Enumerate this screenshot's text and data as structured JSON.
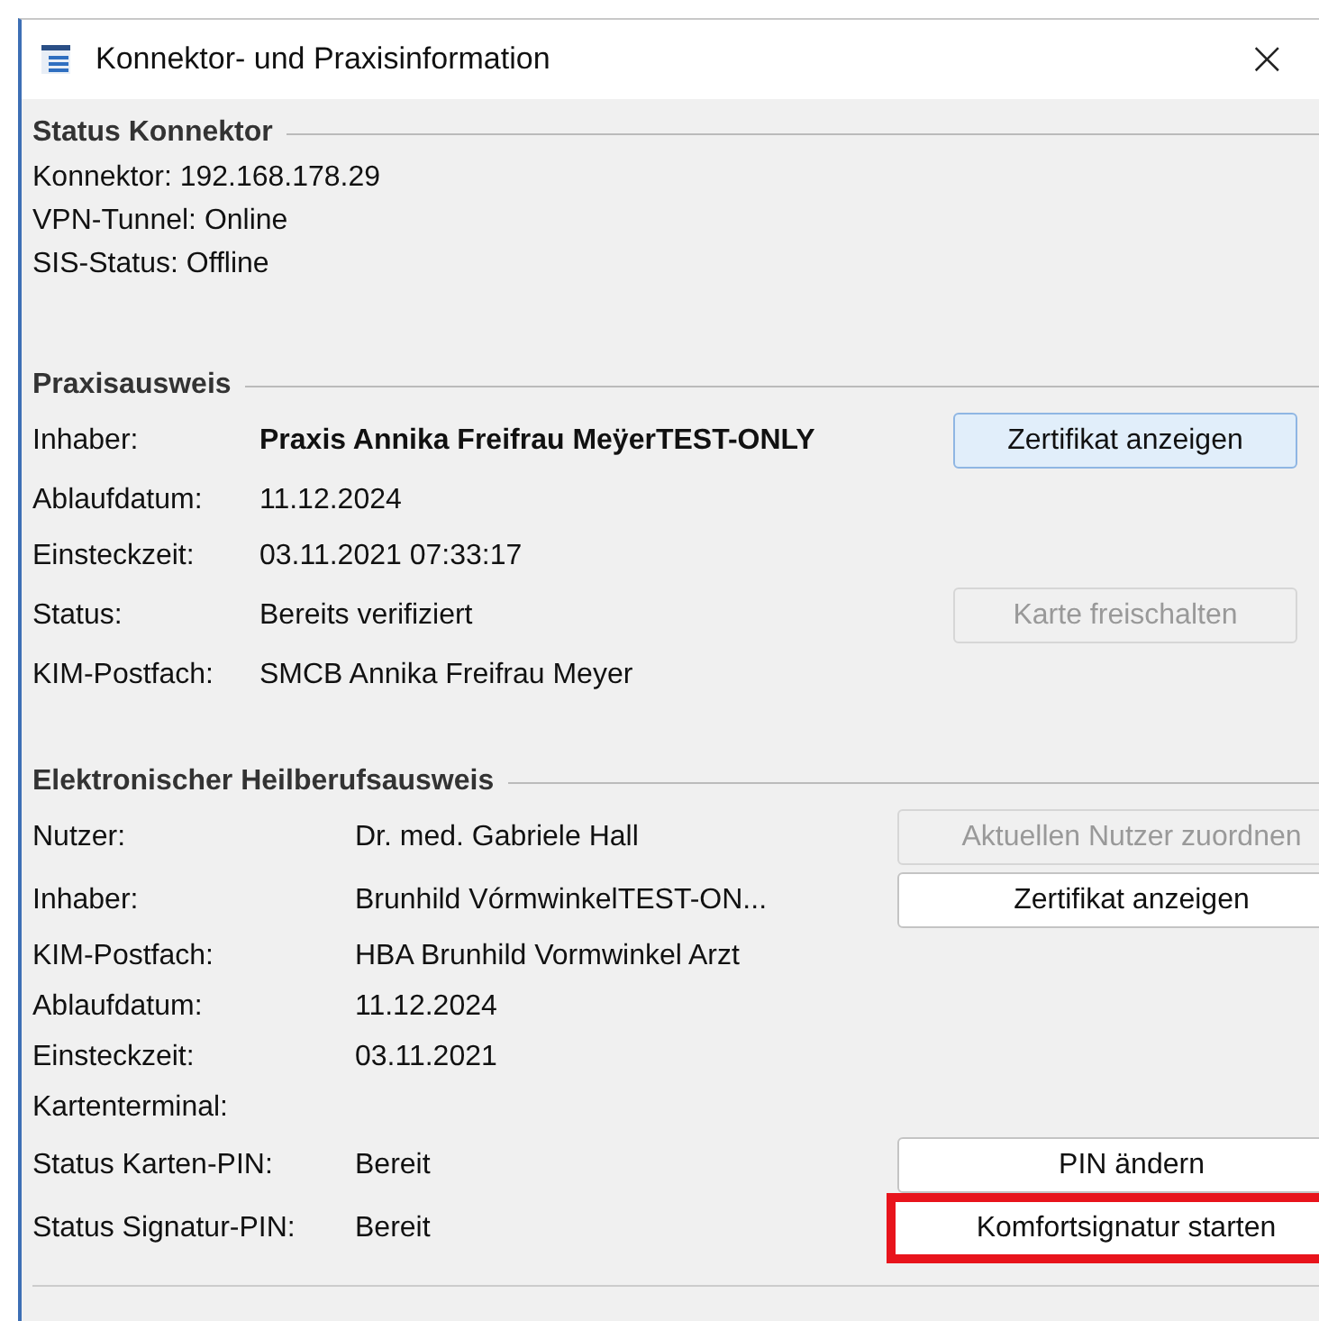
{
  "window": {
    "title": "Konnektor- und Praxisinformation",
    "close": "×"
  },
  "sections": [
    {
      "kind": "status",
      "title": "Status Konnektor",
      "lines": [
        "Konnektor: 192.168.178.29",
        "VPN-Tunnel: Online",
        "SIS-Status: Offline"
      ]
    },
    {
      "kind": "card",
      "title": "Praxisausweis",
      "rows": [
        {
          "label": "Inhaber:",
          "value": "Praxis Annika Freifrau MeÿerTEST-ONLY",
          "bold": true,
          "button": {
            "label": "Zertifikat anzeigen",
            "disabled": false,
            "focused": true,
            "highlighted": false
          }
        },
        {
          "label": "Ablaufdatum:",
          "value": "11.12.2024"
        },
        {
          "label": "Einsteckzeit:",
          "value": "03.11.2021 07:33:17"
        },
        {
          "label": "Status:",
          "value": "Bereits verifiziert",
          "button": {
            "label": "Karte freischalten",
            "disabled": true,
            "focused": false,
            "highlighted": false
          }
        },
        {
          "label": "KIM-Postfach:",
          "value": "SMCB Annika Freifrau Meyer"
        }
      ]
    },
    {
      "kind": "card",
      "title": "Elektronischer Heilberufsausweis",
      "rows": [
        {
          "label": "Nutzer:",
          "value": "Dr. med. Gabriele Hall",
          "button": {
            "label": "Aktuellen Nutzer zuordnen",
            "disabled": true,
            "focused": false,
            "highlighted": false
          }
        },
        {
          "label": "Inhaber:",
          "value": "Brunhild VórmwinkelTEST-ON...",
          "button": {
            "label": "Zertifikat anzeigen",
            "disabled": false,
            "focused": false,
            "highlighted": false
          }
        },
        {
          "label": "KIM-Postfach:",
          "value": "HBA Brunhild Vormwinkel Arzt"
        },
        {
          "label": "Ablaufdatum:",
          "value": "11.12.2024"
        },
        {
          "label": "Einsteckzeit:",
          "value": "03.11.2021"
        },
        {
          "label": "Kartenterminal:"
        },
        {
          "label": "Status Karten-PIN:",
          "value": "Bereit",
          "button": {
            "label": "PIN ändern",
            "disabled": false,
            "focused": false,
            "highlighted": false
          }
        },
        {
          "label": "Status Signatur-PIN:",
          "value": "Bereit",
          "button": {
            "label": "Komfortsignatur starten",
            "disabled": false,
            "focused": false,
            "highlighted": true
          }
        }
      ]
    }
  ]
}
